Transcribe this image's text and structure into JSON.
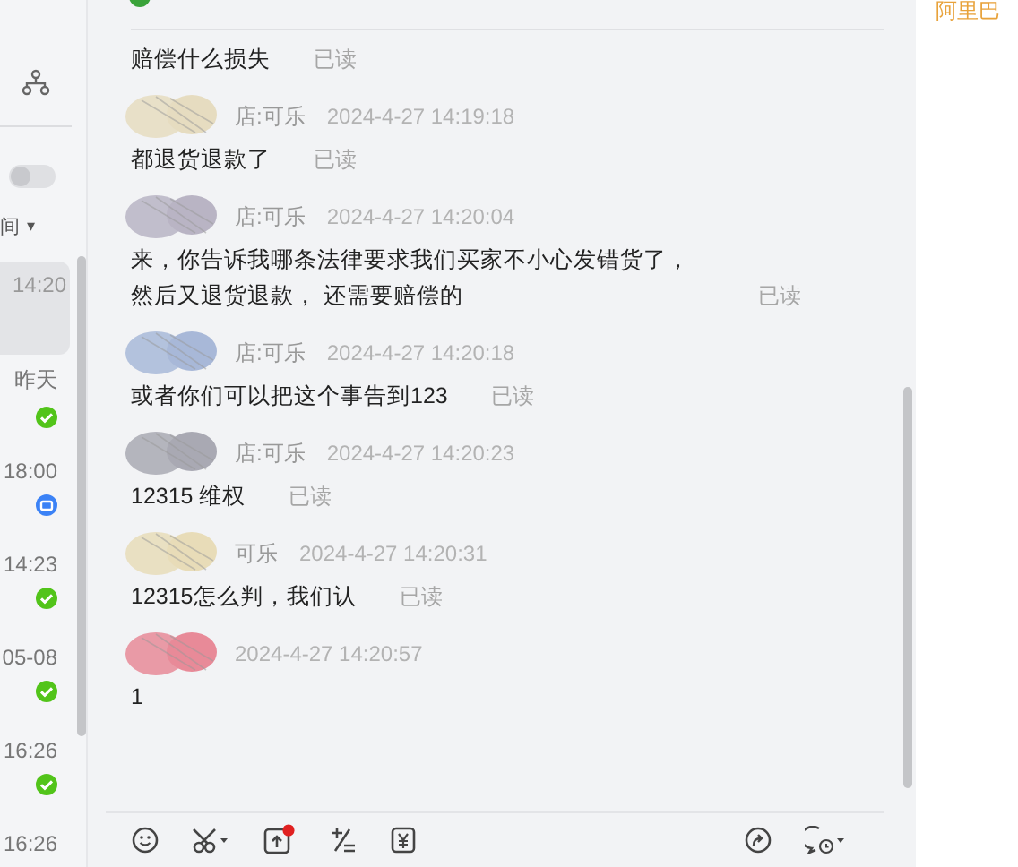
{
  "sidebar": {
    "sort_label": "间",
    "sort_caret": "▾",
    "toggle_on": false,
    "conversations": [
      {
        "time": "14:20",
        "selected": true,
        "kind": "plain"
      },
      {
        "time": "昨天",
        "selected": false,
        "kind": "check"
      },
      {
        "time": "18:00",
        "selected": false,
        "kind": "mail"
      },
      {
        "time": "14:23",
        "selected": false,
        "kind": "check"
      },
      {
        "time": "05-08",
        "selected": false,
        "kind": "check"
      },
      {
        "time": "16:26",
        "selected": false,
        "kind": "check"
      },
      {
        "time": "16:26",
        "selected": false,
        "kind": "plain"
      }
    ]
  },
  "chat": {
    "messages": [
      {
        "text": "赔偿什么损失",
        "read": "已读"
      },
      {
        "sender": "店:可乐",
        "time": "2024-4-27 14:19:18",
        "color": "#e6dcc0",
        "text": "都退货退款了",
        "read": "已读"
      },
      {
        "sender": "店:可乐",
        "time": "2024-4-27 14:20:04",
        "color": "#b9b4c4",
        "lines": [
          "来，你告诉我哪条法律要求我们买家不小心发错货了，",
          "然后又退货退款， 还需要赔偿的"
        ],
        "read": "已读"
      },
      {
        "sender": "店:可乐",
        "time": "2024-4-27 14:20:18",
        "color": "#a8b8d8",
        "text": "或者你们可以把这个事告到123",
        "read": "已读"
      },
      {
        "sender": "店:可乐",
        "time": "2024-4-27 14:20:23",
        "color": "#a9a9b3",
        "text": "12315 维权",
        "read": "已读"
      },
      {
        "sender": "可乐",
        "time": "2024-4-27 14:20:31",
        "color": "#e8dcb8",
        "text": "12315怎么判，我们认",
        "read": "已读"
      },
      {
        "time": "2024-4-27 14:20:57",
        "color": "#e88a98",
        "text": "1"
      }
    ]
  },
  "toolbar": {
    "upload_badge": true
  },
  "side_panel": {
    "title": "阿里巴"
  }
}
